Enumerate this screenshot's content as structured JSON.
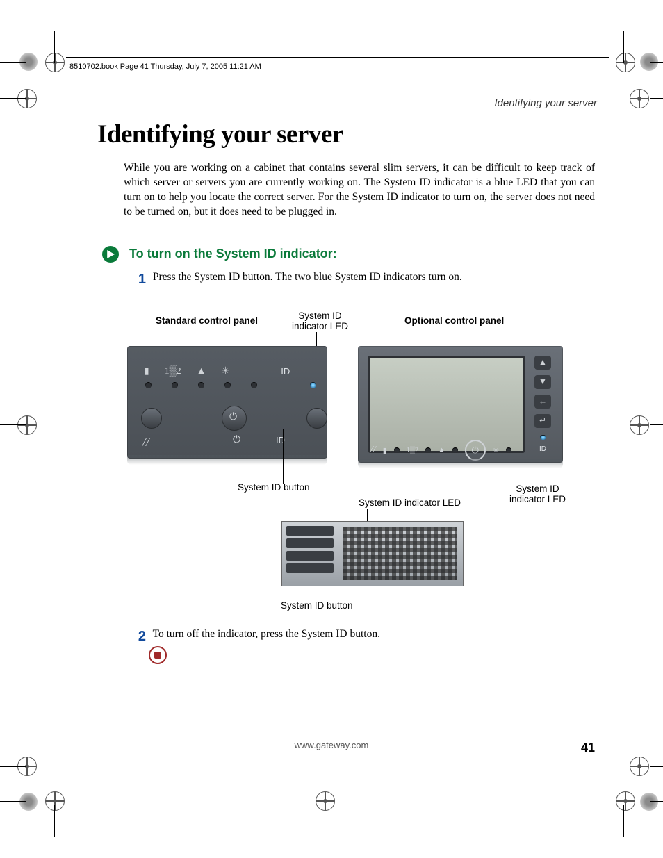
{
  "meta": {
    "book_line": "8510702.book  Page 41  Thursday, July 7, 2005  11:21 AM"
  },
  "running_head": "Identifying your server",
  "title": "Identifying your server",
  "intro": "While you are working on a cabinet that contains several slim servers, it can be difficult to keep track of which server or servers you are currently working on. The System ID indicator is a blue LED that you can turn on to help you locate the correct server. For the System ID indicator to turn on, the server does not need to be turned on, but it does need to be plugged in.",
  "procedure_title": "To turn on the System ID indicator:",
  "steps": {
    "one_num": "1",
    "one_text": "Press the System ID button. The two blue System ID indicators turn on.",
    "two_num": "2",
    "two_text": "To turn off the indicator, press the System ID button."
  },
  "labels": {
    "standard_panel": "Standard control panel",
    "optional_panel": "Optional control panel",
    "sysid_led_top": "System ID\nindicator LED",
    "sysid_button_mid": "System ID button",
    "sysid_led_bottom": "System ID indicator LED",
    "sysid_led_right": "System ID\nindicator LED",
    "sysid_button_bottom": "System ID button",
    "id_text": "ID"
  },
  "panel1_icons": {
    "net1": "1",
    "net2": "2"
  },
  "footer": {
    "url": "www.gateway.com",
    "page": "41"
  }
}
